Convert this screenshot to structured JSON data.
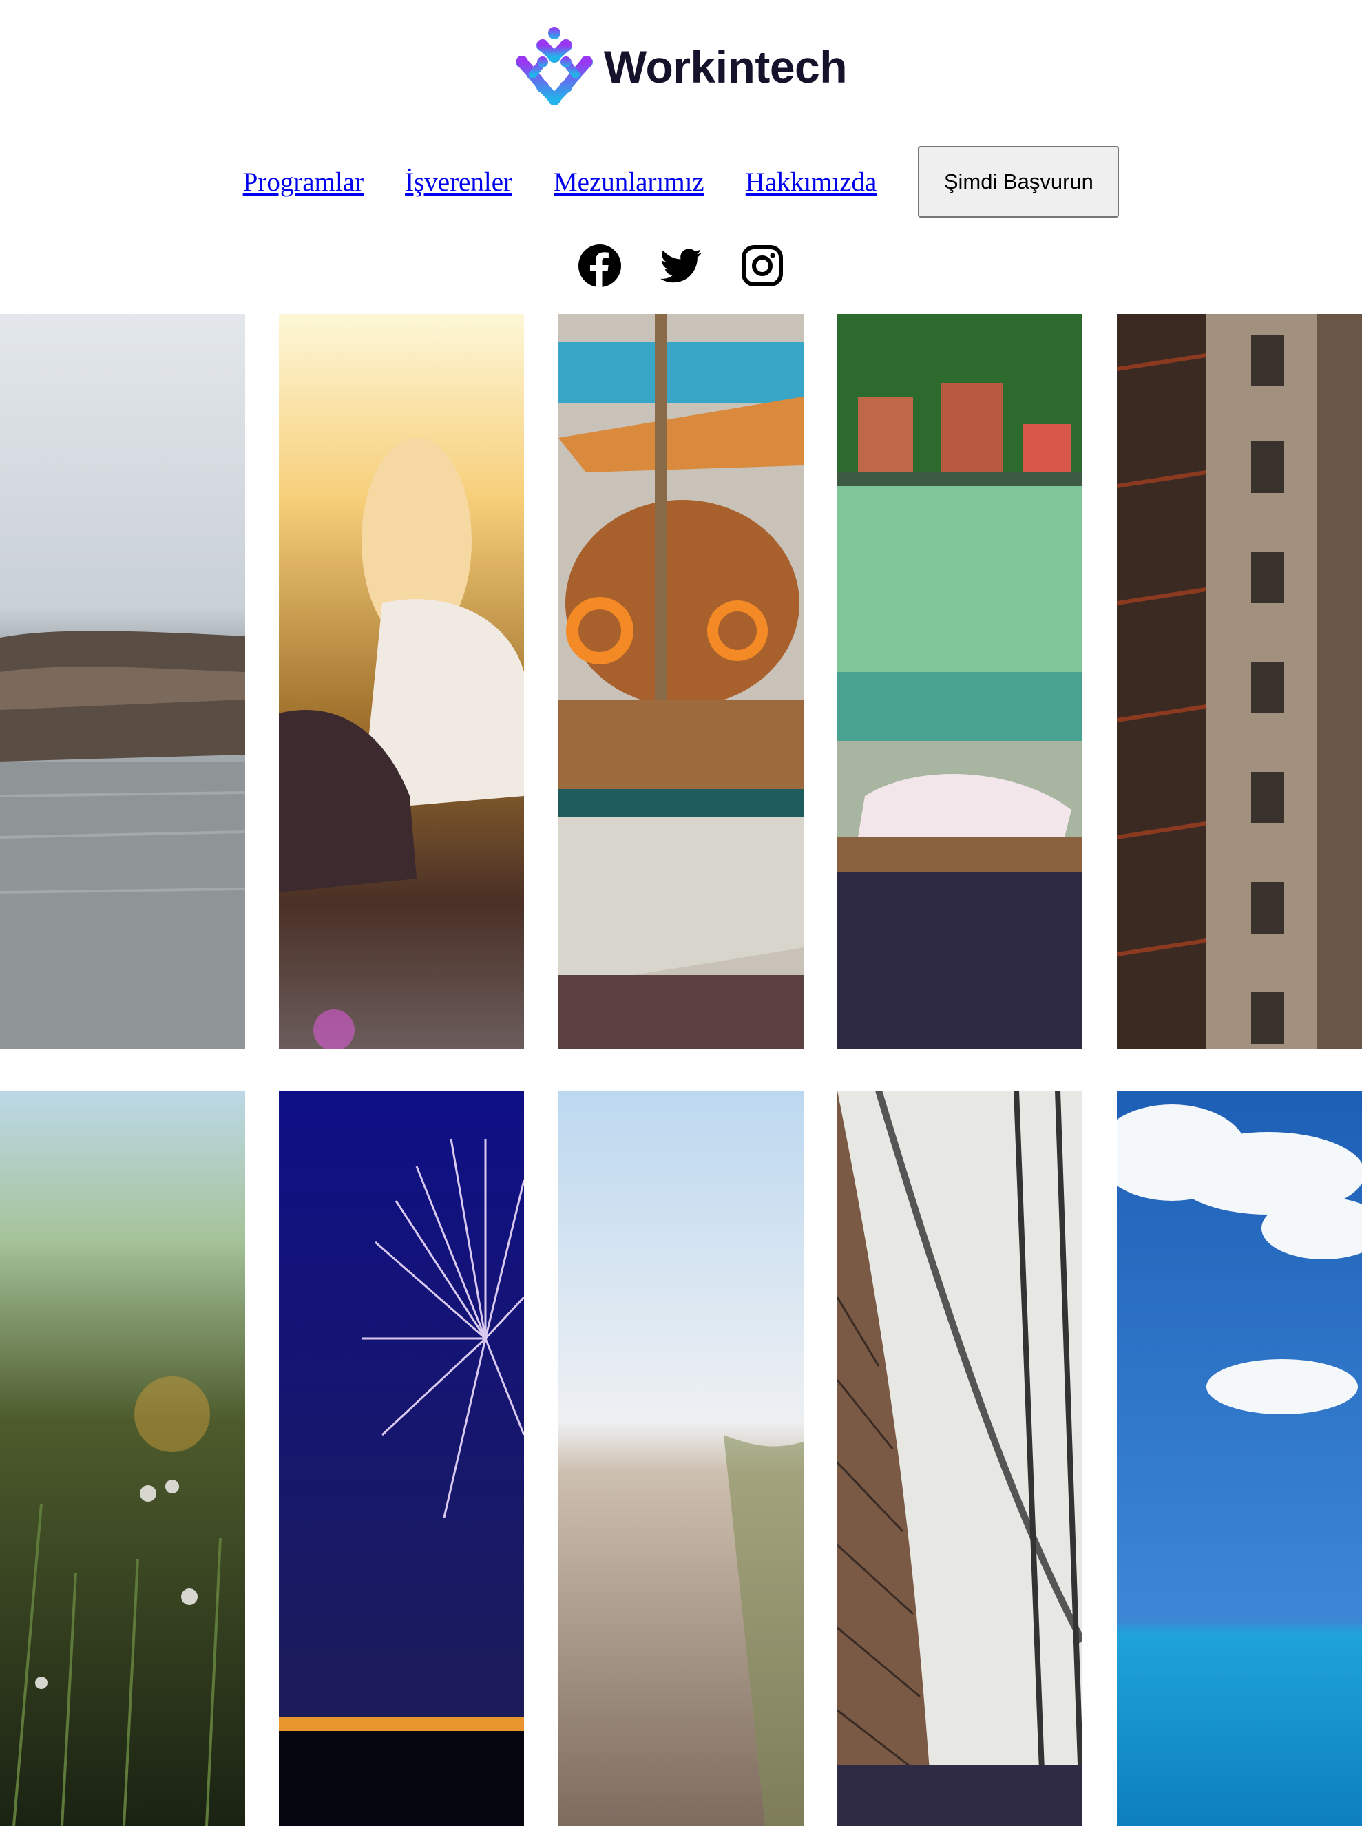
{
  "header": {
    "brand_name": "Workintech",
    "logo_icon": "workintech-logo-icon"
  },
  "nav": {
    "links": [
      {
        "label": "Programlar"
      },
      {
        "label": "İşverenler"
      },
      {
        "label": "Mezunlarımız"
      },
      {
        "label": "Hakkımızda"
      }
    ],
    "cta_label": "Şimdi Başvurun"
  },
  "social": [
    "facebook-icon",
    "twitter-icon",
    "instagram-icon"
  ],
  "colors": {
    "brand_text": "#15132b",
    "link": "#0000ee",
    "logo_purple": "#8b3ff0",
    "logo_blue": "#2f8cf0"
  },
  "gallery": {
    "rows": [
      [
        "sea-rocks-photo",
        "girl-sunset-photo",
        "sailboat-photo",
        "plants-table-photo",
        "brick-building-photo"
      ],
      [
        "meadow-flowers-photo",
        "fireworks-photo",
        "beach-path-photo",
        "library-shelves-photo",
        "sky-ocean-photo"
      ]
    ]
  }
}
